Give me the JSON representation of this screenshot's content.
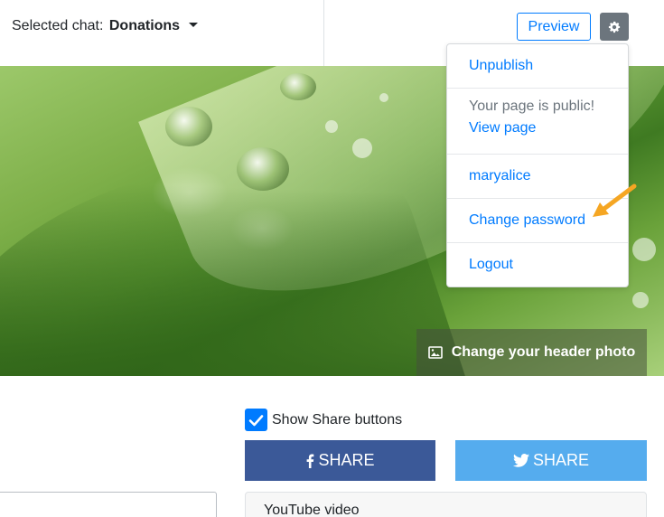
{
  "header": {
    "selected_chat_label": "Selected chat:",
    "selected_chat_value": "Donations",
    "preview_label": "Preview",
    "settings_icon": "gear-icon"
  },
  "settings_menu": {
    "unpublish": "Unpublish",
    "public_status": "Your page is public!",
    "view_page": "View page",
    "username": "maryalice",
    "change_password": "Change password",
    "logout": "Logout",
    "annotation_arrow_color": "#f5a623"
  },
  "header_photo": {
    "change_label": "Change your header photo",
    "icon": "image-icon"
  },
  "share": {
    "show_buttons_label": "Show Share buttons",
    "show_buttons_checked": true,
    "facebook_label": "SHARE",
    "facebook_icon": "facebook-icon",
    "facebook_color": "#3b5998",
    "twitter_label": "SHARE",
    "twitter_icon": "twitter-icon",
    "twitter_color": "#55acee"
  },
  "youtube": {
    "label": "YouTube video"
  },
  "colors": {
    "primary": "#007bff",
    "secondary": "#6c757d"
  }
}
